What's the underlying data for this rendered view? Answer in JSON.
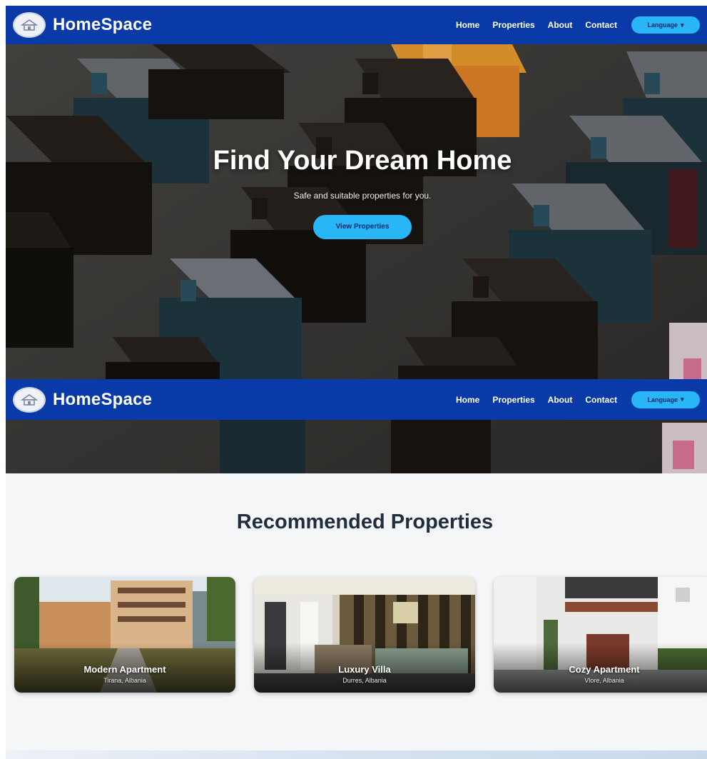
{
  "nav": {
    "brand": "HomeSpace",
    "links": [
      "Home",
      "Properties",
      "About",
      "Contact"
    ],
    "language_label": "Language"
  },
  "hero": {
    "title": "Find Your Dream Home",
    "subtitle": "Safe and suitable properties for you.",
    "cta_label": "View Properties"
  },
  "recommended": {
    "title": "Recommended Properties",
    "cards": [
      {
        "name": "Modern Apartment",
        "location": "Tirana, Albania"
      },
      {
        "name": "Luxury Villa",
        "location": "Durres, Albania"
      },
      {
        "name": "Cozy Apartment",
        "location": "Vlore, Albania"
      }
    ]
  },
  "colors": {
    "nav_bg": "#0a3aa8",
    "accent": "#29b6f6",
    "heading": "#1f2d3d"
  },
  "icons": [
    "house-logo-icon",
    "chevron-down-icon"
  ]
}
